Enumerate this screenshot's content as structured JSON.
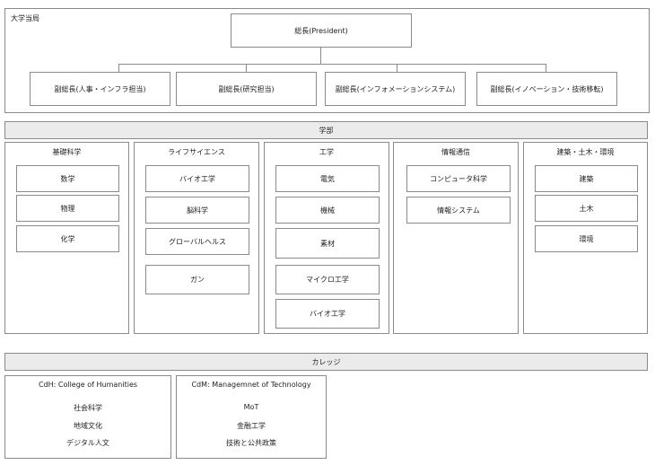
{
  "administration": {
    "label": "大学当局",
    "president": "総長(President)",
    "vice_presidents": [
      "副総長(人事・インフラ担当)",
      "副総長(研究担当)",
      "副総長(インフォメーションシステム)",
      "副総長(イノベーション・技術移転)"
    ]
  },
  "faculties": {
    "title": "学部",
    "columns": [
      {
        "title": "基礎科学",
        "items": [
          "数学",
          "物理",
          "化学"
        ]
      },
      {
        "title": "ライフサイエンス",
        "items": [
          "バイオ工学",
          "脳科学",
          "グローバルヘルス",
          "ガン"
        ]
      },
      {
        "title": "工学",
        "items": [
          "電気",
          "機械",
          "素材",
          "マイクロ工学",
          "バイオ工学"
        ]
      },
      {
        "title": "情報通信",
        "items": [
          "コンピュータ科学",
          "情報システム"
        ]
      },
      {
        "title": "建築・土木・環境",
        "items": [
          "建築",
          "土木",
          "環境"
        ]
      }
    ]
  },
  "colleges": {
    "title": "カレッジ",
    "list": [
      {
        "title": "CdH: College of Humanities",
        "items": [
          "社会科学",
          "地域文化",
          "デジタル人文"
        ]
      },
      {
        "title": "CdM: Managemnet of Technology",
        "items": [
          "MoT",
          "金融工学",
          "技術と公共政策"
        ]
      }
    ]
  }
}
